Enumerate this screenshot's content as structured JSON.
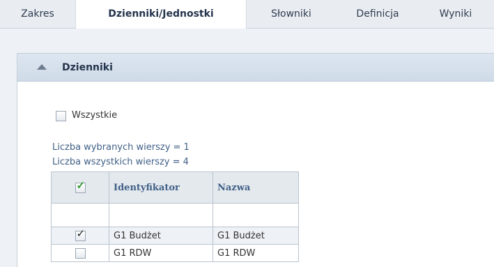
{
  "tabs": [
    {
      "label": "Zakres",
      "active": false
    },
    {
      "label": "Dzienniki/Jednostki",
      "active": true
    },
    {
      "label": "Słowniki",
      "active": false
    },
    {
      "label": "Definicja",
      "active": false
    },
    {
      "label": "Wyniki",
      "active": false
    }
  ],
  "panel": {
    "title": "Dzienniki",
    "select_all_label": "Wszystkie",
    "selected_count_text": "Liczba wybranych wierszy = 1",
    "total_count_text": "Liczba wszystkich wierszy = 4"
  },
  "grid": {
    "columns": [
      "Identyfikator",
      "Nazwa"
    ],
    "rows": [
      {
        "checked": true,
        "id": "G1 Budżet",
        "name": "G1 Budżet"
      },
      {
        "checked": false,
        "id": "G1 RDW",
        "name": "G1 RDW"
      }
    ]
  },
  "icons": {
    "panel_toggle": "triangle-up-icon",
    "header_checkbox": "green-checkmark-icon"
  }
}
